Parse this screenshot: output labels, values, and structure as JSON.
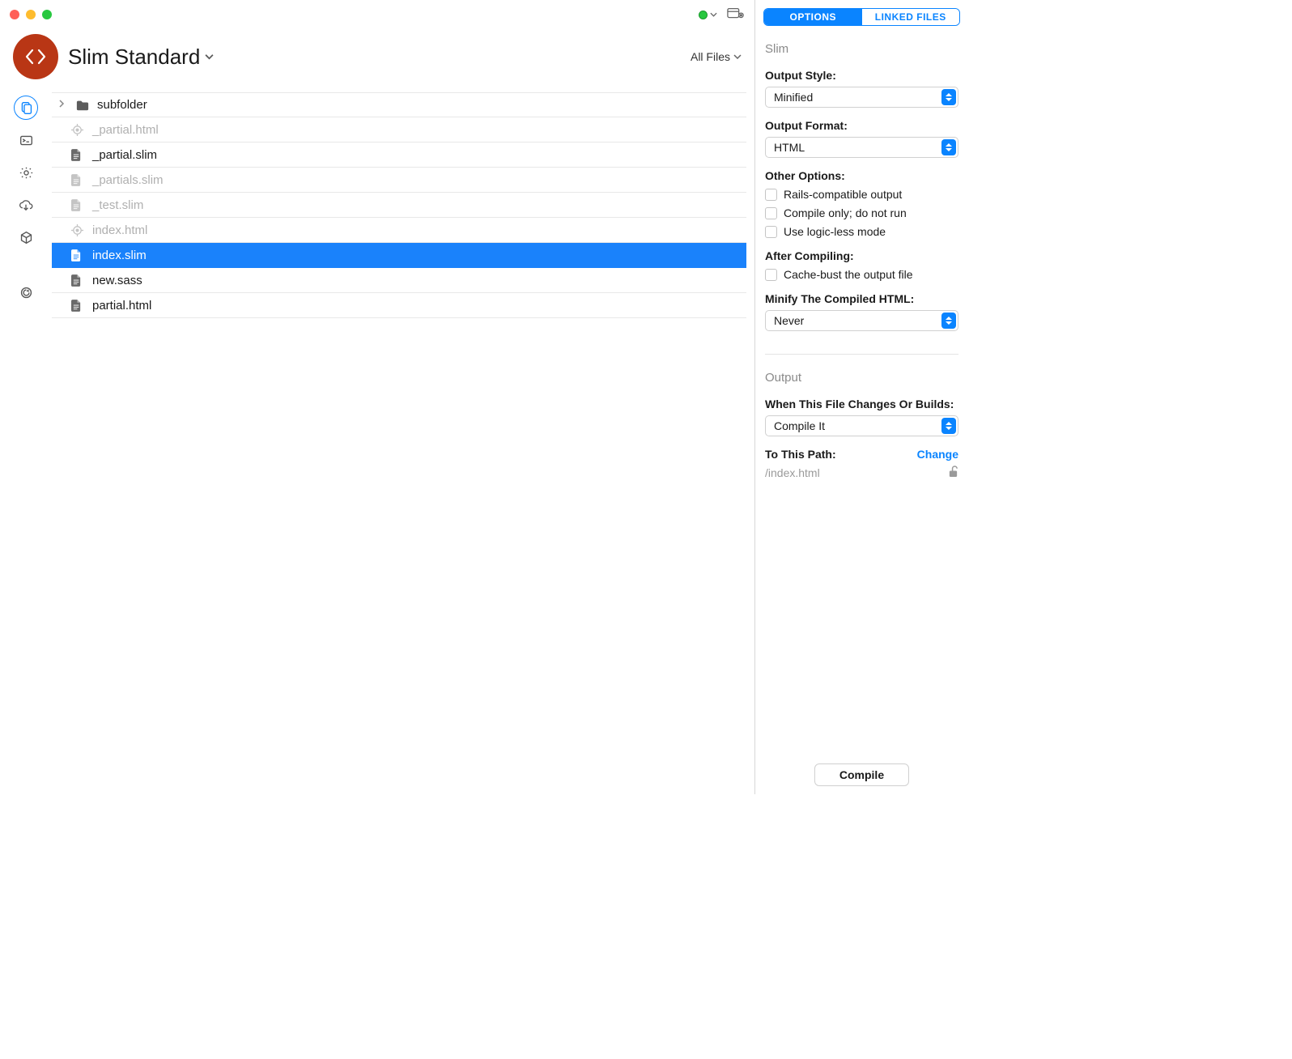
{
  "project": {
    "name": "Slim Standard"
  },
  "filter": {
    "label": "All Files"
  },
  "files": [
    {
      "name": "subfolder",
      "type": "folder",
      "dim": false
    },
    {
      "name": "_partial.html",
      "type": "target",
      "dim": true
    },
    {
      "name": "_partial.slim",
      "type": "file",
      "dim": false
    },
    {
      "name": "_partials.slim",
      "type": "file",
      "dim": true
    },
    {
      "name": "_test.slim",
      "type": "file",
      "dim": true
    },
    {
      "name": "index.html",
      "type": "target",
      "dim": true
    },
    {
      "name": "index.slim",
      "type": "file",
      "dim": false,
      "selected": true
    },
    {
      "name": "new.sass",
      "type": "file",
      "dim": false
    },
    {
      "name": "partial.html",
      "type": "file",
      "dim": false
    }
  ],
  "tabs": {
    "options": "OPTIONS",
    "linked": "LINKED FILES"
  },
  "panel": {
    "lang_title": "Slim",
    "output_style": {
      "label": "Output Style:",
      "value": "Minified"
    },
    "output_format": {
      "label": "Output Format:",
      "value": "HTML"
    },
    "other_options": {
      "label": "Other Options:",
      "rails": "Rails-compatible output",
      "compile_only": "Compile only; do not run",
      "logicless": "Use logic-less mode"
    },
    "after_compiling": {
      "label": "After Compiling:",
      "cache_bust": "Cache-bust the output file"
    },
    "minify": {
      "label": "Minify The Compiled HTML:",
      "value": "Never"
    },
    "output_section": "Output",
    "when_changes": {
      "label": "When This File Changes Or Builds:",
      "value": "Compile It"
    },
    "to_path": {
      "label": "To This Path:",
      "change": "Change",
      "value": "/index.html"
    },
    "compile_btn": "Compile"
  }
}
